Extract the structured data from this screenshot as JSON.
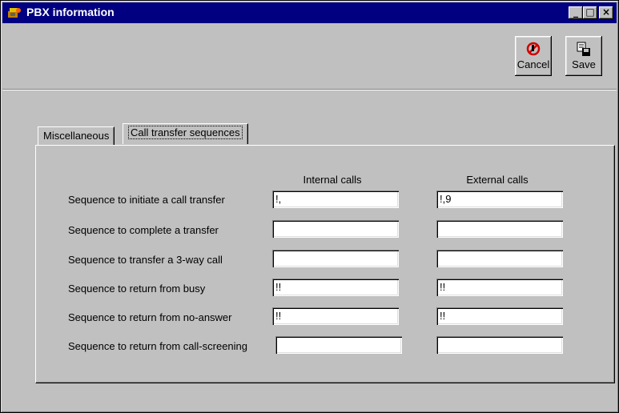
{
  "window": {
    "title": "PBX information",
    "title_icon": "pbx-app-icon",
    "controls": {
      "minimize": "_",
      "maximize": "□",
      "close": "×"
    }
  },
  "toolbar": {
    "cancel": {
      "label": "Cancel",
      "icon": "cancel-icon"
    },
    "save": {
      "label": "Save",
      "icon": "save-icon"
    }
  },
  "tabs": [
    {
      "label": "Miscellaneous",
      "active": false
    },
    {
      "label": "Call transfer sequences",
      "active": true
    }
  ],
  "columns": {
    "internal": "Internal calls",
    "external": "External calls"
  },
  "rows": [
    {
      "label": "Sequence to initiate a call transfer",
      "internal": "!,",
      "external": "!,9"
    },
    {
      "label": "Sequence to complete a transfer",
      "internal": "",
      "external": ""
    },
    {
      "label": "Sequence to transfer a 3-way call",
      "internal": "",
      "external": ""
    },
    {
      "label": "Sequence to return from busy",
      "internal": "!!",
      "external": "!!"
    },
    {
      "label": "Sequence to return from no-answer",
      "internal": "!!",
      "external": "!!"
    },
    {
      "label": "Sequence to return from call-screening",
      "internal": "",
      "external": ""
    }
  ]
}
